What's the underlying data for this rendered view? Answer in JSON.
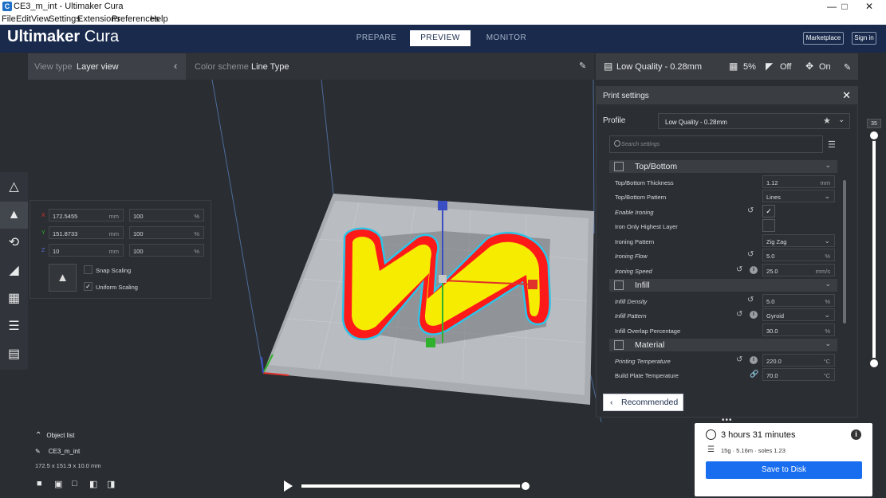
{
  "window": {
    "title": "CE3_m_int - Ultimaker Cura",
    "app_icon": "C",
    "controls": [
      "minimize",
      "maximize",
      "close"
    ]
  },
  "menu": [
    "File",
    "Edit",
    "View",
    "Settings",
    "Extensions",
    "Preferences",
    "Help"
  ],
  "header": {
    "brand_main": "Ultimaker",
    "brand_sub": "Cura",
    "stages": [
      "PREPARE",
      "PREVIEW",
      "MONITOR"
    ],
    "active_stage": "PREVIEW",
    "marketplace_label": "Marketplace",
    "signin_label": "Sign in",
    "background_color": "#192a4d"
  },
  "viewbar": {
    "view_type_label": "View type",
    "view_type_value": "Layer view",
    "color_scheme_label": "Color scheme",
    "color_scheme_value": "Line Type"
  },
  "print_summary": {
    "profile": "Low Quality - 0.28mm",
    "infill": "5%",
    "support": "Off",
    "adhesion": "On"
  },
  "print_settings": {
    "title": "Print settings",
    "profile_label": "Profile",
    "profile_value": "Low Quality - 0.28mm",
    "search_placeholder": "Search settings",
    "recommended_label": "Recommended",
    "categories": {
      "top_bottom": "Top/Bottom",
      "infill": "Infill",
      "material": "Material"
    },
    "rows": {
      "tb_thickness": {
        "label": "Top/Bottom Thickness",
        "value": "1.12",
        "unit": "mm"
      },
      "tb_pattern": {
        "label": "Top/Bottom Pattern",
        "value": "Lines"
      },
      "enable_ironing": {
        "label": "Enable Ironing",
        "checked": true
      },
      "iron_only_highest": {
        "label": "Iron Only Highest Layer",
        "checked": false
      },
      "ironing_pattern": {
        "label": "Ironing Pattern",
        "value": "Zig Zag"
      },
      "ironing_flow": {
        "label": "Ironing Flow",
        "value": "5.0",
        "unit": "%"
      },
      "ironing_speed": {
        "label": "Ironing Speed",
        "value": "25.0",
        "unit": "mm/s"
      },
      "infill_density": {
        "label": "Infill Density",
        "value": "5.0",
        "unit": "%"
      },
      "infill_pattern": {
        "label": "Infill Pattern",
        "value": "Gyroid"
      },
      "infill_overlap": {
        "label": "Infill Overlap Percentage",
        "value": "30.0",
        "unit": "%"
      },
      "print_temp": {
        "label": "Printing Temperature",
        "value": "220.0",
        "unit": "°C"
      },
      "bed_temp": {
        "label": "Build Plate Temperature",
        "value": "70.0",
        "unit": "°C"
      }
    }
  },
  "scale_tool": {
    "x": {
      "axis": "X",
      "mm": "172.5455",
      "mm_unit": "mm",
      "pct": "100",
      "pct_unit": "%"
    },
    "y": {
      "axis": "Y",
      "mm": "151.8733",
      "mm_unit": "mm",
      "pct": "100",
      "pct_unit": "%"
    },
    "z": {
      "axis": "Z",
      "mm": "10",
      "mm_unit": "mm",
      "pct": "100",
      "pct_unit": "%"
    },
    "snap_scaling_label": "Snap Scaling",
    "snap_scaling_checked": false,
    "uniform_scaling_label": "Uniform Scaling",
    "uniform_scaling_checked": true,
    "axis_colors": {
      "x": "#e0312b",
      "y": "#2fb12d",
      "z": "#3b4fc4"
    }
  },
  "object_info": {
    "object_list_label": "Object list",
    "object_name": "CE3_m_int",
    "dimensions": "172.5 x 151.9 x 10.0 mm"
  },
  "layer_slider": {
    "current_layer": "35",
    "min_fraction": 0.0,
    "max_fraction": 1.0
  },
  "path_slider": {
    "position_fraction": 1.0
  },
  "output": {
    "print_time": "3 hours 31 minutes",
    "material_info": "15g · 5.16m · soles 1.23",
    "save_label": "Save to Disk",
    "save_color": "#196ef0"
  },
  "colors": {
    "infill": "#f5ec00",
    "wall_outer": "#ff1a1a",
    "skin_edge": "#2fc3e8",
    "build_plate": "#b9bcc0"
  }
}
